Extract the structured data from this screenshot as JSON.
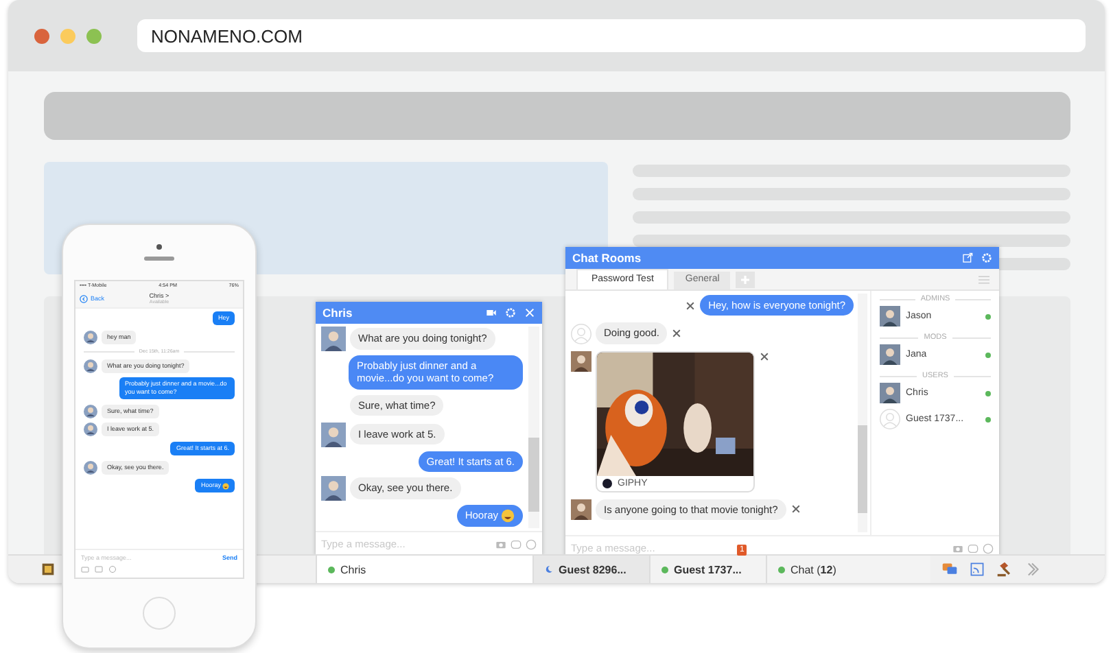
{
  "browser": {
    "address": "NONAMENO.COM"
  },
  "phone": {
    "carrier": "•••• T-Mobile",
    "time": "4:54 PM",
    "battery": "76%",
    "back_label": "Back",
    "contact": "Chris >",
    "contact_status": "Available",
    "placeholder": "Type a message...",
    "send_label": "Send",
    "messages": [
      {
        "kind": "sent",
        "text": "Hey"
      },
      {
        "kind": "received",
        "text": "hey man"
      },
      {
        "kind": "divider",
        "text": "Dec 15th, 11:26am"
      },
      {
        "kind": "received",
        "text": "What are you doing tonight?"
      },
      {
        "kind": "sent",
        "text": "Probably just dinner and a movie...do you want to come?"
      },
      {
        "kind": "received",
        "text": "Sure, what time?"
      },
      {
        "kind": "received",
        "text": "I leave work at 5."
      },
      {
        "kind": "sent",
        "text": "Great! It starts at 6."
      },
      {
        "kind": "received",
        "text": "Okay, see you there."
      },
      {
        "kind": "sent",
        "text": "Hooray",
        "emoji": true
      }
    ]
  },
  "chat_window": {
    "title": "Chris",
    "placeholder": "Type a message...",
    "messages": [
      {
        "kind": "received",
        "avatar": true,
        "text": "What are you doing tonight?"
      },
      {
        "kind": "sent",
        "text": "Probably just dinner and a movie...do you want to come?"
      },
      {
        "kind": "received",
        "avatar": false,
        "text": "Sure, what time?"
      },
      {
        "kind": "received",
        "avatar": true,
        "text": "I leave work at 5."
      },
      {
        "kind": "sent",
        "text": "Great! It starts at 6."
      },
      {
        "kind": "received",
        "avatar": true,
        "text": "Okay, see you there."
      },
      {
        "kind": "sent",
        "text": "Hooray",
        "emoji": true
      }
    ]
  },
  "chat_rooms": {
    "title": "Chat Rooms",
    "placeholder": "Type a message...",
    "tabs": [
      {
        "label": "Password Test",
        "selected": true
      },
      {
        "label": "General",
        "selected": false
      }
    ],
    "messages": [
      {
        "kind": "sent",
        "text": "Hey, how is everyone tonight?"
      },
      {
        "kind": "received",
        "photo": false,
        "text": "Doing good."
      },
      {
        "kind": "gif",
        "photo": true,
        "caption": "GIPHY"
      },
      {
        "kind": "received",
        "photo": true,
        "text": "Is anyone going to that movie tonight?"
      }
    ],
    "groups": [
      {
        "label": "ADMINS",
        "users": [
          {
            "name": "Jason",
            "photo": true,
            "color": "#5cb85c"
          }
        ]
      },
      {
        "label": "MODS",
        "users": [
          {
            "name": "Jana",
            "photo": true,
            "color": "#5cb85c"
          }
        ]
      },
      {
        "label": "USERS",
        "users": [
          {
            "name": "Chris",
            "photo": true,
            "color": "#5cb85c"
          },
          {
            "name": "Guest 1737...",
            "photo": false,
            "color": "#5cb85c"
          }
        ]
      }
    ]
  },
  "taskbar": {
    "tabs": [
      {
        "label": "Chris",
        "kind": "online",
        "color": "#5cb85c"
      },
      {
        "label": "Guest 8296...",
        "kind": "away",
        "color": "#4a7fe0"
      },
      {
        "label": "Guest 1737...",
        "kind": "online",
        "color": "#5cb85c",
        "badge": "1"
      },
      {
        "label": "Chat (**12**)",
        "kind": "online",
        "color": "#5cb85c"
      }
    ]
  }
}
